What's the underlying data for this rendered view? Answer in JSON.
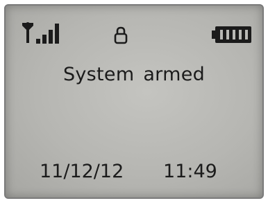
{
  "status_bar": {
    "signal_icon": "signal-strength-icon",
    "signal_bars": 4,
    "lock_icon": "padlock-icon",
    "battery_icon": "battery-full-icon",
    "battery_level": 1.0
  },
  "main": {
    "message": "System armed"
  },
  "footer": {
    "date": "11/12/12",
    "time": "11:49"
  },
  "colors": {
    "lcd_background": "#b9b9b5",
    "lcd_text": "#1b1b1b"
  }
}
